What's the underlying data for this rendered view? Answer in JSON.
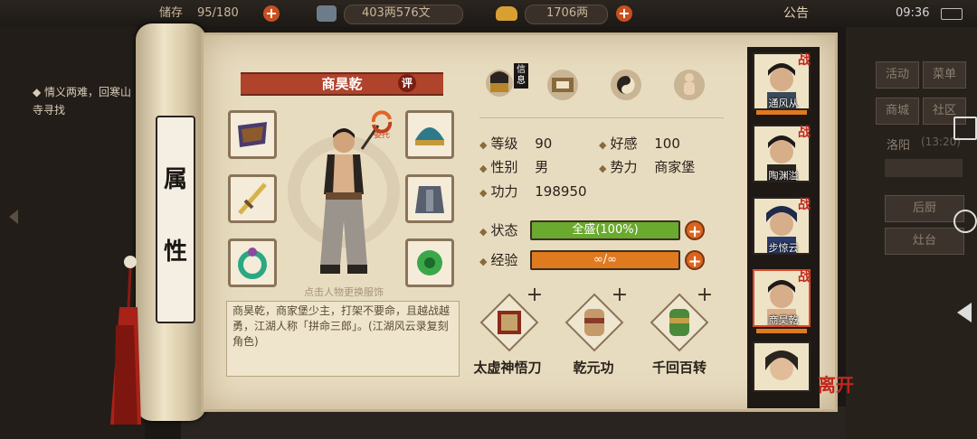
{
  "topbar": {
    "capacity_label": "储存",
    "capacity_value": "95/180",
    "money_copper": "403两576文",
    "money_silver": "1706两",
    "announcement": "公告",
    "time": "09:36"
  },
  "quest": {
    "text": "◆ 情义两难，回寒山寺寻找"
  },
  "right_panel": {
    "buttons": [
      "活动",
      "菜单",
      "商城",
      "社区"
    ],
    "location": "洛阳",
    "location_time": "(13:20)",
    "kitchen": "后厨",
    "stove": "灶台"
  },
  "scroll": {
    "attr_chars": [
      "属",
      "性"
    ]
  },
  "character": {
    "name": "商昊乾",
    "eval_badge": "评",
    "entrust_label": "委托",
    "change_hint": "点击人物更换服饰",
    "description": "商昊乾，商家堡少主，打架不要命，且越战越勇，江湖人称「拼命三郎」。(江湖风云录复刻角色)",
    "info_tab_label": "信息"
  },
  "stats": {
    "level_label": "等级",
    "level_value": "90",
    "affinity_label": "好感",
    "affinity_value": "100",
    "gender_label": "性别",
    "gender_value": "男",
    "faction_label": "势力",
    "faction_value": "商家堡",
    "power_label": "功力",
    "power_value": "198950",
    "status_label": "状态",
    "status_value": "全盛(100%)",
    "status_fill": 1.0,
    "exp_label": "经验",
    "exp_value": "∞/∞",
    "exp_fill": 1.0
  },
  "skills": [
    {
      "name": "太虚神悟刀"
    },
    {
      "name": "乾元功"
    },
    {
      "name": "千回百转"
    }
  ],
  "roster": [
    {
      "name": "通风从",
      "battle": "战"
    },
    {
      "name": "陶渊溢",
      "battle": "战"
    },
    {
      "name": "步惊云",
      "battle": "战"
    },
    {
      "name": "商昊乾",
      "battle": "战"
    },
    {
      "name": "",
      "battle": ""
    }
  ],
  "leave_label": "离开",
  "colors": {
    "status_bar": "#6aaa2e",
    "exp_bar": "#e07a1e",
    "banner": "#b0432c",
    "accent_red": "#c0281c"
  }
}
